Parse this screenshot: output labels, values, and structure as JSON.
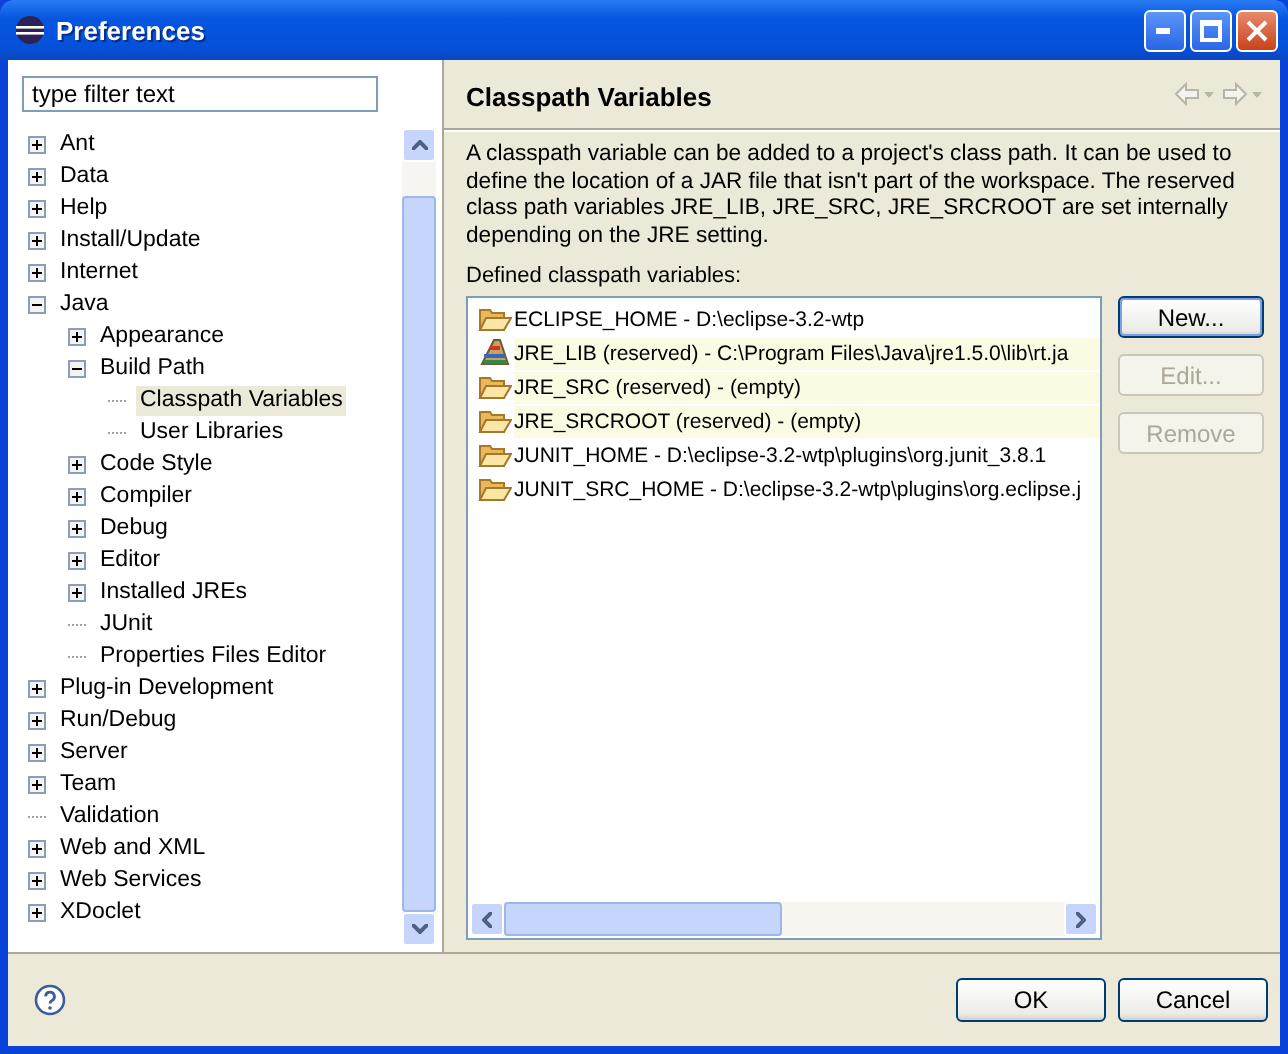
{
  "window": {
    "title": "Preferences"
  },
  "filter": {
    "value": "type filter text"
  },
  "tree": [
    {
      "label": "Ant",
      "expanded": false,
      "selected": false
    },
    {
      "label": "Data",
      "expanded": false,
      "selected": false
    },
    {
      "label": "Help",
      "expanded": false,
      "selected": false
    },
    {
      "label": "Install/Update",
      "expanded": false,
      "selected": false
    },
    {
      "label": "Internet",
      "expanded": false,
      "selected": false
    },
    {
      "label": "Java",
      "expanded": true,
      "selected": false,
      "children": [
        {
          "label": "Appearance",
          "expanded": false,
          "selected": false
        },
        {
          "label": "Build Path",
          "expanded": true,
          "selected": false,
          "children": [
            {
              "label": "Classpath Variables",
              "selected": true
            },
            {
              "label": "User Libraries",
              "selected": false
            }
          ]
        },
        {
          "label": "Code Style",
          "expanded": false,
          "selected": false
        },
        {
          "label": "Compiler",
          "expanded": false,
          "selected": false
        },
        {
          "label": "Debug",
          "expanded": false,
          "selected": false
        },
        {
          "label": "Editor",
          "expanded": false,
          "selected": false
        },
        {
          "label": "Installed JREs",
          "expanded": false,
          "selected": false
        },
        {
          "label": "JUnit",
          "selected": false
        },
        {
          "label": "Properties Files Editor",
          "selected": false
        }
      ]
    },
    {
      "label": "Plug-in Development",
      "expanded": false,
      "selected": false
    },
    {
      "label": "Run/Debug",
      "expanded": false,
      "selected": false
    },
    {
      "label": "Server",
      "expanded": false,
      "selected": false
    },
    {
      "label": "Team",
      "expanded": false,
      "selected": false
    },
    {
      "label": "Validation",
      "selected": false
    },
    {
      "label": "Web and XML",
      "expanded": false,
      "selected": false
    },
    {
      "label": "Web Services",
      "expanded": false,
      "selected": false
    },
    {
      "label": "XDoclet",
      "expanded": false,
      "selected": false
    }
  ],
  "page": {
    "title": "Classpath Variables",
    "navigation": {
      "disabled": true
    },
    "description": "A classpath variable can be added to a project's class path. It can be used to define the location of a JAR file that isn't part of the workspace. The reserved class path variables JRE_LIB, JRE_SRC, JRE_SRCROOT are set internally depending on the JRE setting.",
    "list_label": "Defined classpath variables:",
    "variables": [
      {
        "text": "ECLIPSE_HOME - D:\\eclipse-3.2-wtp",
        "kind": "folder",
        "reserved": false
      },
      {
        "text": "JRE_LIB (reserved) - C:\\Program Files\\Java\\jre1.5.0\\lib\\rt.ja",
        "kind": "library",
        "reserved": true
      },
      {
        "text": "JRE_SRC (reserved) - (empty)",
        "kind": "folder",
        "reserved": true
      },
      {
        "text": "JRE_SRCROOT (reserved) - (empty)",
        "kind": "folder",
        "reserved": true
      },
      {
        "text": "JUNIT_HOME - D:\\eclipse-3.2-wtp\\plugins\\org.junit_3.8.1",
        "kind": "folder",
        "reserved": false
      },
      {
        "text": "JUNIT_SRC_HOME - D:\\eclipse-3.2-wtp\\plugins\\org.eclipse.j",
        "kind": "folder",
        "reserved": false
      }
    ],
    "buttons": [
      {
        "label": "New...",
        "disabled": false,
        "default": true
      },
      {
        "label": "Edit...",
        "disabled": true,
        "default": false
      },
      {
        "label": "Remove",
        "disabled": true,
        "default": false
      }
    ]
  },
  "footer": {
    "buttons": [
      {
        "label": "OK"
      },
      {
        "label": "Cancel"
      }
    ]
  }
}
